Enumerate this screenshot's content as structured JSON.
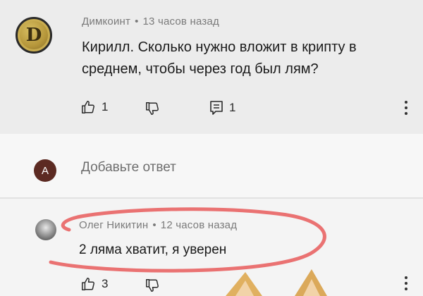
{
  "thread": {
    "comment": {
      "author": "Димкоинт",
      "separator": "•",
      "time": "13 часов назад",
      "text_line1": "Кирилл. Сколько нужно вложит в крипту в",
      "text_line2": "среднем, чтобы через год был лям?",
      "likes": "1",
      "replies": "1",
      "avatar_letter": "D"
    },
    "reply_box": {
      "avatar_letter": "A",
      "placeholder": "Добавьте ответ"
    },
    "reply": {
      "author": "Олег Никитин",
      "separator": "•",
      "time": "12 часов назад",
      "text": "2 ляма хватит, я уверен",
      "likes": "3"
    }
  },
  "colors": {
    "annotation_circle": "#e85a5a",
    "reply_avatar": "#5c2a22"
  }
}
